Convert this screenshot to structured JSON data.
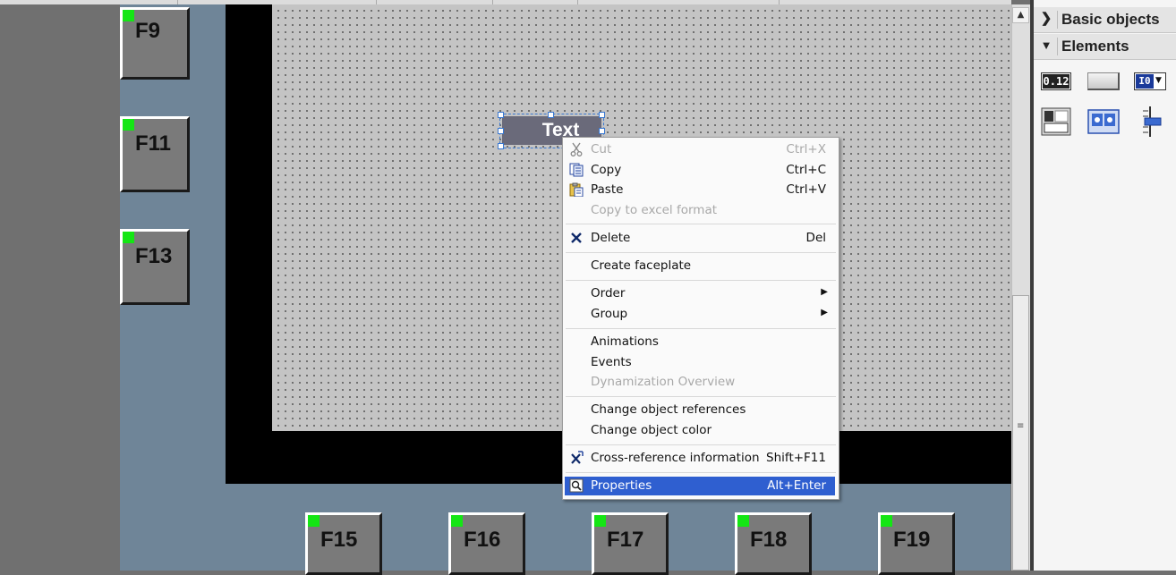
{
  "function_keys": {
    "left": [
      "F9",
      "F11",
      "F13"
    ],
    "bottom": [
      "F15",
      "F16",
      "F17",
      "F18",
      "F19"
    ]
  },
  "canvas": {
    "text_object": "Text"
  },
  "context_menu": {
    "cut": {
      "label": "Cut",
      "shortcut": "Ctrl+X",
      "icon": "scissors-icon"
    },
    "copy": {
      "label": "Copy",
      "shortcut": "Ctrl+C",
      "icon": "copy-icon"
    },
    "paste": {
      "label": "Paste",
      "shortcut": "Ctrl+V",
      "icon": "paste-icon"
    },
    "copy_excel": {
      "label": "Copy to excel format"
    },
    "delete": {
      "label": "Delete",
      "shortcut": "Del",
      "icon": "delete-icon"
    },
    "create_faceplate": {
      "label": "Create faceplate"
    },
    "order": {
      "label": "Order"
    },
    "group": {
      "label": "Group"
    },
    "animations": {
      "label": "Animations"
    },
    "events": {
      "label": "Events"
    },
    "dynamization_overview": {
      "label": "Dynamization Overview"
    },
    "change_object_references": {
      "label": "Change object references"
    },
    "change_object_color": {
      "label": "Change object color"
    },
    "cross_reference": {
      "label": "Cross-reference information",
      "shortcut": "Shift+F11",
      "icon": "cross-reference-icon"
    },
    "properties": {
      "label": "Properties",
      "shortcut": "Alt+Enter",
      "icon": "properties-icon"
    }
  },
  "toolbox": {
    "basic_objects": "Basic objects",
    "elements": "Elements",
    "io_field_icon_text": "0.12",
    "symbolic_io_icon_text": "I0"
  },
  "colors": {
    "led": "#14e614",
    "highlight": "#2f5fd0"
  }
}
